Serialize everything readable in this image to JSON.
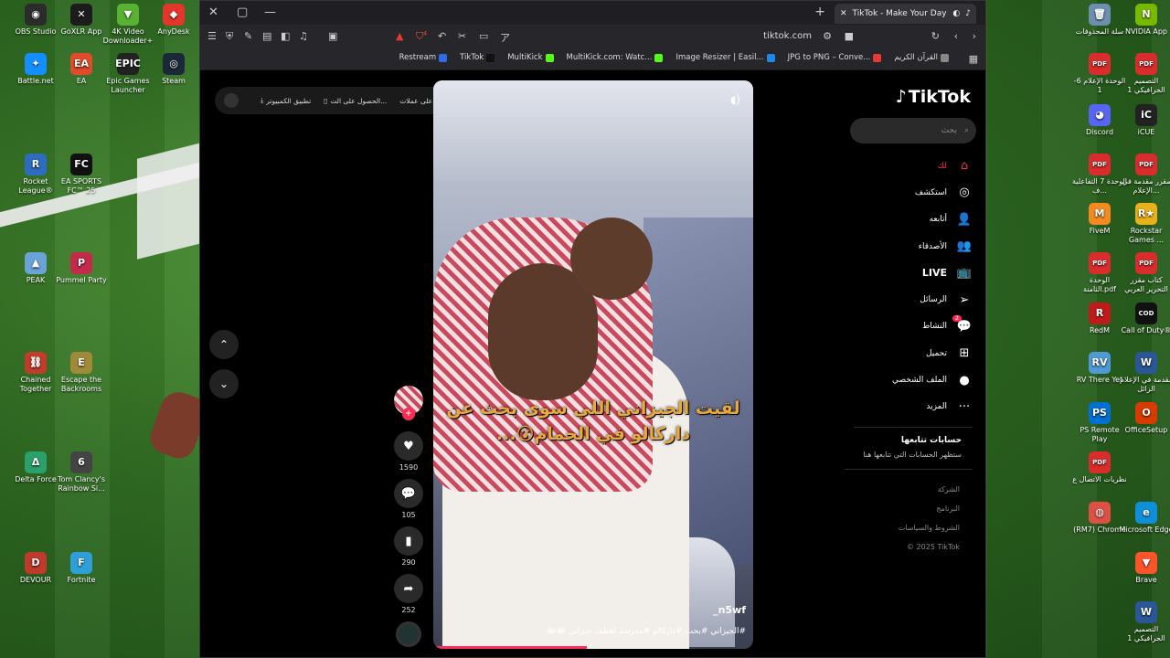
{
  "desktop": {
    "left_icons": [
      {
        "label": "OBS Studio",
        "color": "#2b2b2b",
        "glyph": "◉"
      },
      {
        "label": "GoXLR App",
        "color": "#1c1c1c",
        "glyph": "✕"
      },
      {
        "label": "4K Video Downloader+",
        "color": "#59b233",
        "glyph": "▼"
      },
      {
        "label": "AnyDesk",
        "color": "#e2362b",
        "glyph": "◆"
      },
      {
        "label": "Battle.net",
        "color": "#148eff",
        "glyph": "✦"
      },
      {
        "label": "EA",
        "color": "#e14b29",
        "glyph": "EA"
      },
      {
        "label": "Epic Games Launcher",
        "color": "#222",
        "glyph": "EPIC"
      },
      {
        "label": "Steam",
        "color": "#1b2838",
        "glyph": "◎"
      },
      {
        "label": "Rocket League®",
        "color": "#2d6cc0",
        "glyph": "R"
      },
      {
        "label": "EA SPORTS FC™ 25",
        "color": "#111",
        "glyph": "FC"
      },
      {
        "label": "PEAK",
        "color": "#6aa3d8",
        "glyph": "▲"
      },
      {
        "label": "Pummel Party",
        "color": "#c42a4a",
        "glyph": "P"
      },
      {
        "label": "Chained Together",
        "color": "#c23b2b",
        "glyph": "⛓"
      },
      {
        "label": "Escape the Backrooms",
        "color": "#a08a3a",
        "glyph": "E"
      },
      {
        "label": "Delta Force",
        "color": "#2ba06a",
        "glyph": "Δ"
      },
      {
        "label": "Tom Clancy's Rainbow Si...",
        "color": "#444",
        "glyph": "6"
      },
      {
        "label": "DEVOUR",
        "color": "#c0392b",
        "glyph": "D"
      },
      {
        "label": "Fortnite",
        "color": "#2f9fd8",
        "glyph": "F"
      }
    ],
    "right_icons": [
      {
        "label": "سلة المحذوفات",
        "color": "#6c8fb0",
        "glyph": "🗑"
      },
      {
        "label": "NVIDIA App",
        "color": "#76b900",
        "glyph": "N"
      },
      {
        "label": "الوحدة الإعلام 6-1",
        "color": "#d92c2c",
        "glyph": "PDF"
      },
      {
        "label": "التصميم الجرافيكي 1",
        "color": "#d92c2c",
        "glyph": "PDF"
      },
      {
        "label": "Discord",
        "color": "#5865f2",
        "glyph": "◕"
      },
      {
        "label": "iCUE",
        "color": "#222",
        "glyph": "iC"
      },
      {
        "label": "الوحدة 7 التفاعلية ف...",
        "color": "#d92c2c",
        "glyph": "PDF"
      },
      {
        "label": "مقرر مقدمة في الإعلام...",
        "color": "#d92c2c",
        "glyph": "PDF"
      },
      {
        "label": "FiveM",
        "color": "#f28a1f",
        "glyph": "M"
      },
      {
        "label": "Rockstar Games ...",
        "color": "#e8b11c",
        "glyph": "R★"
      },
      {
        "label": "الوحدة الثامنة.pdf",
        "color": "#d92c2c",
        "glyph": "PDF"
      },
      {
        "label": "كتاب مقرر التحرير العربي",
        "color": "#d92c2c",
        "glyph": "PDF"
      },
      {
        "label": "RedM",
        "color": "#c01b1b",
        "glyph": "R"
      },
      {
        "label": "Call of Duty®",
        "color": "#111",
        "glyph": "COD"
      },
      {
        "label": "RV There Yet",
        "color": "#4e9ad6",
        "glyph": "RV"
      },
      {
        "label": "مقدمة في الإعلام الزائل",
        "color": "#2b5797",
        "glyph": "W"
      },
      {
        "label": "PS Remote Play",
        "color": "#0070d1",
        "glyph": "PS"
      },
      {
        "label": "OfficeSetup",
        "color": "#d83b01",
        "glyph": "O"
      },
      {
        "label": "نظريات الاتصال ع",
        "color": "#d92c2c",
        "glyph": "PDF"
      },
      {
        "label": "(RM7) Chrome",
        "color": "#dd5144",
        "glyph": "◍"
      },
      {
        "label": "Microsoft Edge",
        "color": "#0f8fd8",
        "glyph": "e"
      },
      {
        "label": "Brave",
        "color": "#fb542b",
        "glyph": "▼"
      },
      {
        "label": "التصميم الجرافيكي 1",
        "color": "#2b5797",
        "glyph": "W"
      }
    ]
  },
  "browser": {
    "tab_title": "TikTok - Make Your Day",
    "url": "tiktok.com",
    "bookmarks": [
      {
        "label": "Restream",
        "color": "#2e6be6"
      },
      {
        "label": "TikTok",
        "color": "#111"
      },
      {
        "label": "MultiKick",
        "color": "#53fc18"
      },
      {
        "label": "MultiKick.com: Watc...",
        "color": "#53fc18"
      },
      {
        "label": "Image Resizer | Easil...",
        "color": "#1e88e5"
      },
      {
        "label": "JPG to PNG – Conve...",
        "color": "#e53935"
      },
      {
        "label": "القرآن الكريم",
        "color": "#888"
      }
    ],
    "shield_count": "4"
  },
  "tiktok": {
    "logo": "TikTok",
    "search_placeholder": "بحث",
    "nav": [
      {
        "label": "لك",
        "icon": "home-icon",
        "glyph": "⌂",
        "active": true
      },
      {
        "label": "استكشف",
        "icon": "compass-icon",
        "glyph": "◎"
      },
      {
        "label": "أتابعه",
        "icon": "user-follow-icon",
        "glyph": "👤"
      },
      {
        "label": "الأصدقاء",
        "icon": "friends-icon",
        "glyph": "👥"
      },
      {
        "label": "LIVE",
        "icon": "live-tv-icon",
        "glyph": "📺",
        "live": true
      },
      {
        "label": "الرسائل",
        "icon": "paper-plane-icon",
        "glyph": "➢"
      },
      {
        "label": "النشاط",
        "icon": "activity-icon",
        "glyph": "💬",
        "badge": "2"
      },
      {
        "label": "تحميل",
        "icon": "upload-icon",
        "glyph": "⊞"
      },
      {
        "label": "الملف الشخصي",
        "icon": "profile-avatar-icon",
        "glyph": "●"
      },
      {
        "label": "المزيد",
        "icon": "more-icon",
        "glyph": "···"
      }
    ],
    "following_title": "حسابات تتابعها",
    "following_sub": "ستظهر الحسابات التي تتابعها هنا",
    "footer_links": [
      "الشركة",
      "البرنامج",
      "الشروط والسياسات"
    ],
    "copyright": "© 2025 TikTok",
    "top_pills": [
      "احصل على عملات",
      "الحصول على الت...",
      "تطبيق الكمبيوتر"
    ],
    "video": {
      "caption": "لقيت الجيزاني  اللي سوى بحث عن داركالو في الحمام😮...",
      "username": "_n5wf",
      "description": "#الجيزاني #بحث #داركالو #مدرسة  اهطف جيزاني 😂😂",
      "progress": 0.48
    },
    "actions": {
      "likes": "1590",
      "comments": "105",
      "saves": "290",
      "shares": "252"
    }
  }
}
